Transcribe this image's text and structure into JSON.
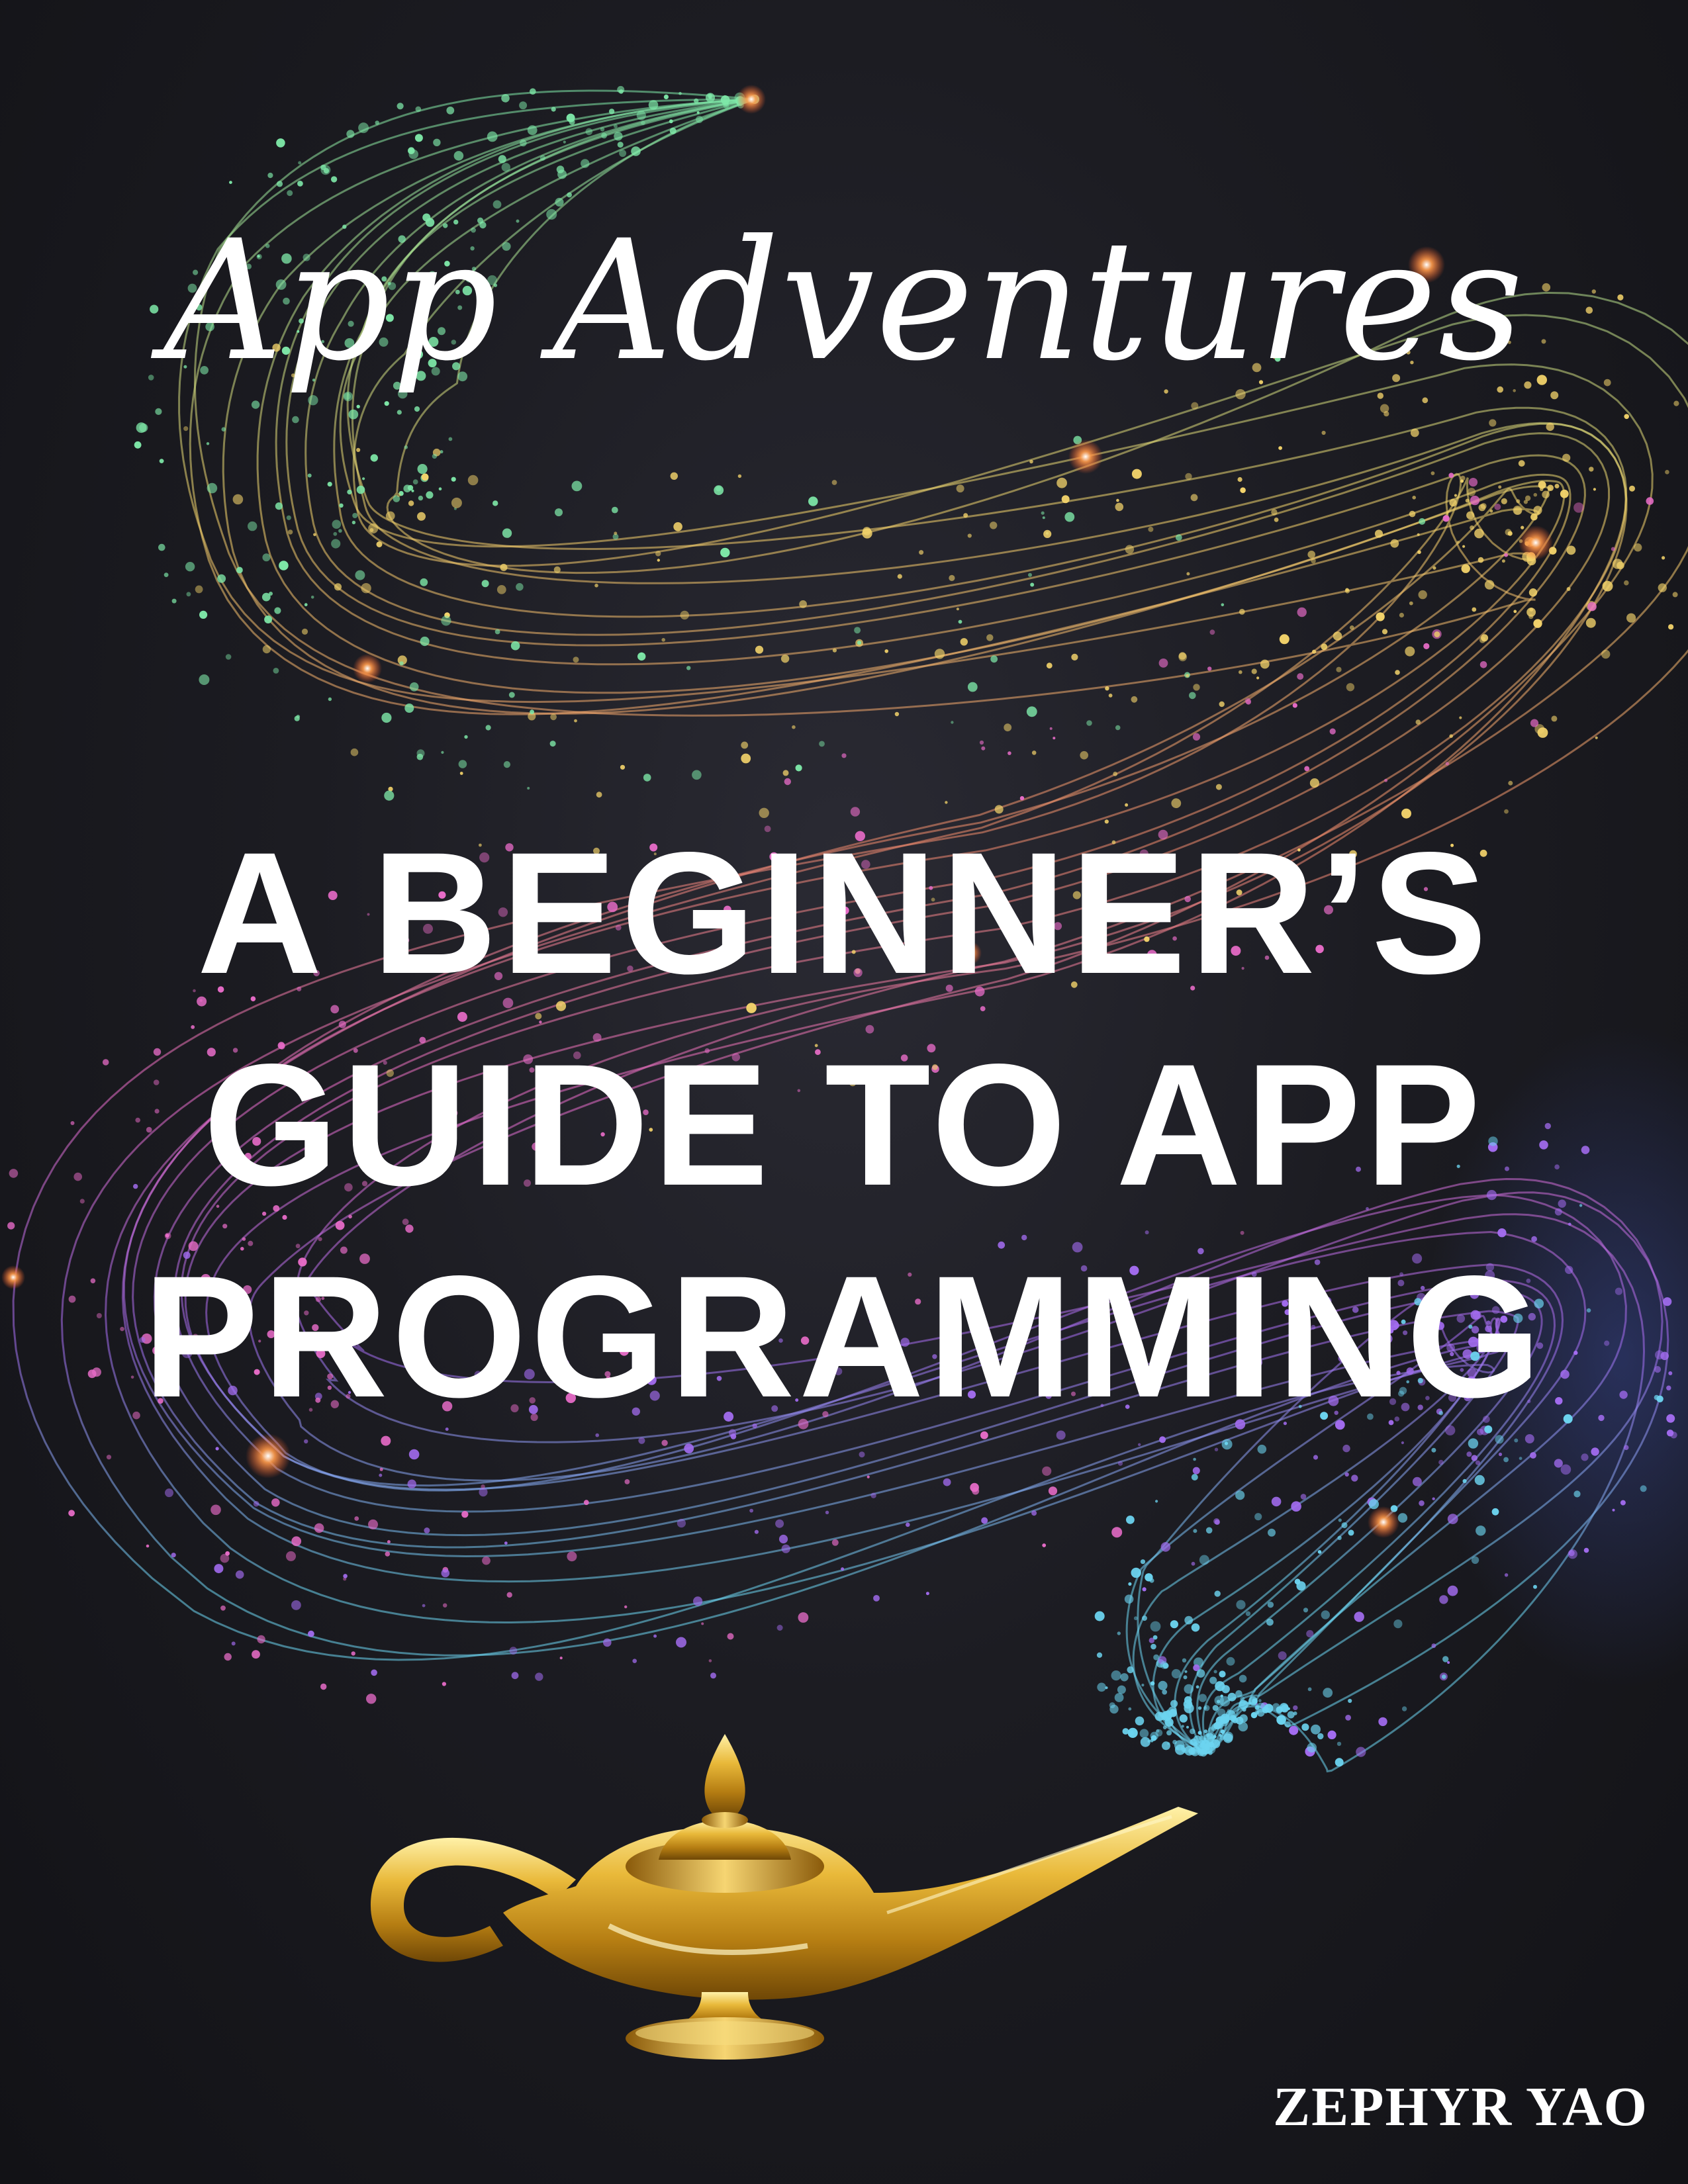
{
  "cover": {
    "series_title": "App Adventures",
    "title_lines": [
      "A BEGINNER’S",
      "GUIDE TO APP",
      "PROGRAMMING"
    ],
    "author": "ZEPHYR YAO"
  },
  "colors": {
    "background": "#1c1c22",
    "text": "#ffffff",
    "sparkle_green": "#7ee8a8",
    "sparkle_yellow": "#f3d36b",
    "sparkle_pink": "#e86cc8",
    "sparkle_purple": "#a36cf0",
    "sparkle_cyan": "#6cd4f0",
    "lamp_gold": "#d9a524"
  },
  "icons": {
    "lamp": "magic-lamp-icon"
  }
}
